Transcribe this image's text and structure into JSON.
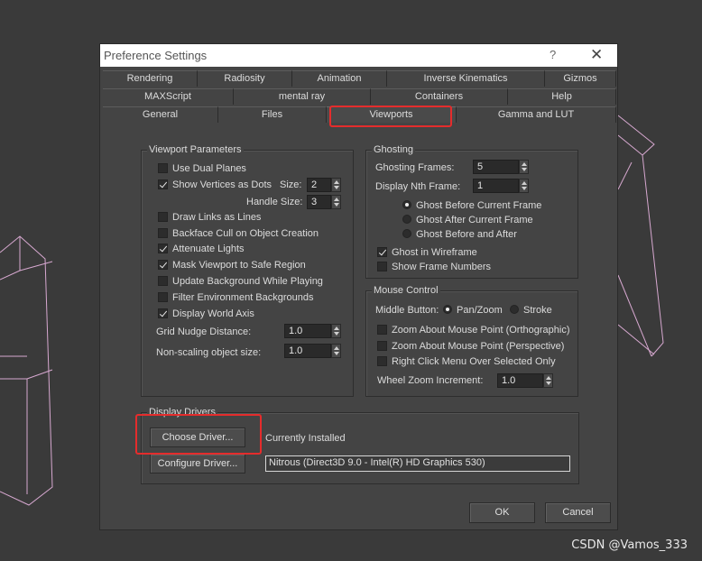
{
  "dialog": {
    "title": "Preference Settings",
    "help_label": "?",
    "close_label": "✕"
  },
  "tabs": {
    "row1": [
      "Rendering",
      "Radiosity",
      "Animation",
      "Inverse Kinematics",
      "Gizmos"
    ],
    "row2": [
      "MAXScript",
      "mental ray",
      "Containers",
      "Help"
    ],
    "row3": [
      "General",
      "Files",
      "Viewports",
      "Gamma and LUT"
    ],
    "active": "Viewports"
  },
  "viewport_parameters": {
    "label": "Viewport Parameters",
    "use_dual_planes": {
      "label": "Use Dual Planes",
      "checked": false
    },
    "show_vertices": {
      "label": "Show Vertices as Dots",
      "checked": true
    },
    "size_label": "Size:",
    "size_value": "2",
    "handle_size_label": "Handle Size:",
    "handle_size_value": "3",
    "draw_links": {
      "label": "Draw Links as Lines",
      "checked": false
    },
    "backface_cull": {
      "label": "Backface Cull on Object Creation",
      "checked": false
    },
    "attenuate_lights": {
      "label": "Attenuate Lights",
      "checked": true
    },
    "mask_viewport": {
      "label": "Mask Viewport to Safe Region",
      "checked": true
    },
    "update_background": {
      "label": "Update Background While Playing",
      "checked": false
    },
    "filter_env": {
      "label": "Filter Environment Backgrounds",
      "checked": false
    },
    "display_world_axis": {
      "label": "Display World Axis",
      "checked": true
    },
    "grid_nudge_label": "Grid Nudge Distance:",
    "grid_nudge_value": "1.0",
    "non_scaling_label": "Non-scaling object size:",
    "non_scaling_value": "1.0"
  },
  "ghosting": {
    "label": "Ghosting",
    "frames_label": "Ghosting Frames:",
    "frames_value": "5",
    "nth_label": "Display Nth Frame:",
    "nth_value": "1",
    "before": {
      "label": "Ghost Before Current Frame",
      "checked": true
    },
    "after": {
      "label": "Ghost After Current Frame",
      "checked": false
    },
    "before_after": {
      "label": "Ghost Before and After",
      "checked": false
    },
    "wireframe": {
      "label": "Ghost in Wireframe",
      "checked": true
    },
    "frame_numbers": {
      "label": "Show Frame Numbers",
      "checked": false
    }
  },
  "mouse_control": {
    "label": "Mouse Control",
    "middle_button_label": "Middle Button:",
    "pan_zoom": {
      "label": "Pan/Zoom",
      "checked": true
    },
    "stroke": {
      "label": "Stroke",
      "checked": false
    },
    "zoom_ortho": {
      "label": "Zoom About Mouse Point (Orthographic)",
      "checked": false
    },
    "zoom_persp": {
      "label": "Zoom About Mouse Point (Perspective)",
      "checked": false
    },
    "right_click": {
      "label": "Right Click Menu Over Selected Only",
      "checked": false
    },
    "wheel_label": "Wheel Zoom Increment:",
    "wheel_value": "1.0"
  },
  "display_drivers": {
    "label": "Display Drivers",
    "choose_label": "Choose Driver...",
    "currently_installed": "Currently Installed",
    "configure_label": "Configure Driver...",
    "driver_name": "Nitrous (Direct3D 9.0 - Intel(R) HD Graphics 530)"
  },
  "footer": {
    "ok_label": "OK",
    "cancel_label": "Cancel"
  },
  "watermark": "CSDN @Vamos_333"
}
